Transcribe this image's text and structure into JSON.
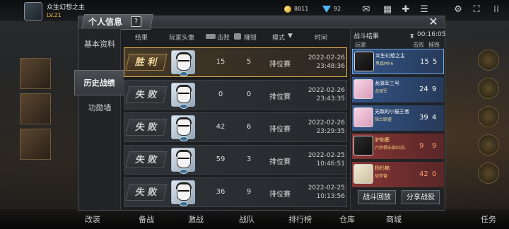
{
  "hud": {
    "player_name": "众生幻想之主",
    "level": "LV.21",
    "mid_text": "",
    "coins": "8011",
    "gems": "92"
  },
  "panel": {
    "title": "个人信息",
    "help": "?",
    "close": "✕"
  },
  "menu": {
    "items": [
      {
        "label": "基本资料",
        "active": false
      },
      {
        "label": "历史战绩",
        "active": true
      },
      {
        "label": "功勋墙",
        "active": false
      }
    ]
  },
  "table": {
    "headers": {
      "result": "结果",
      "avatar": "玩家头像",
      "kills": "击败",
      "destroyed": "摧毁",
      "mode": "模式",
      "mode_arrow": "▼",
      "time": "时间"
    },
    "rows": [
      {
        "result": "胜 利",
        "win": true,
        "kills": "15",
        "destroyed": "5",
        "mode": "排位赛",
        "date": "2022-02-26",
        "time": "23:48:36"
      },
      {
        "result": "失 败",
        "win": false,
        "kills": "0",
        "destroyed": "0",
        "mode": "排位赛",
        "date": "2022-02-26",
        "time": "23:43:35"
      },
      {
        "result": "失 败",
        "win": false,
        "kills": "42",
        "destroyed": "6",
        "mode": "排位赛",
        "date": "2022-02-26",
        "time": "23:29:35"
      },
      {
        "result": "失 败",
        "win": false,
        "kills": "59",
        "destroyed": "3",
        "mode": "排位赛",
        "date": "2022-02-25",
        "time": "10:46:51"
      },
      {
        "result": "失 败",
        "win": false,
        "kills": "36",
        "destroyed": "9",
        "mode": "排位赛",
        "date": "2022-02-25",
        "time": "10:13:56"
      }
    ]
  },
  "detail": {
    "title": "战斗结果",
    "timer": "00:16:05",
    "head_player": "玩家",
    "head_kills": "击败",
    "head_destroyed": "摧毁",
    "players": [
      {
        "name": "众生幻想之主",
        "sub": "黑森林F6",
        "kills": "15",
        "destroyed": "5",
        "team": "blue",
        "self": true,
        "avatar": "dark"
      },
      {
        "name": "龙骑军三号",
        "sub": "龙骑军",
        "kills": "24",
        "destroyed": "9",
        "team": "blue",
        "self": false,
        "avatar": "pink"
      },
      {
        "name": "无敌的小猫王者",
        "sub": "骑士联盟",
        "kills": "39",
        "destroyed": "4",
        "team": "blue",
        "self": false,
        "avatar": "pink"
      },
      {
        "name": "驴和鹿",
        "sub": "六杀俱乐部01队",
        "kills": "9",
        "destroyed": "9",
        "team": "red",
        "self": false,
        "avatar": "dark"
      },
      {
        "name": "杨杉楠",
        "sub": "战斧营",
        "kills": "42",
        "destroyed": "0",
        "team": "red",
        "self": false,
        "avatar": "cream"
      }
    ],
    "replay_button": "战斗回放",
    "share_button": "分享战役"
  },
  "bottom_nav": [
    "改装",
    "备战",
    "激战",
    "战队",
    "排行榜",
    "仓库",
    "商城"
  ],
  "right_side": {
    "task": "任务"
  },
  "colors": {
    "win_border": "#d8a84a",
    "blue_team": "#34588c",
    "red_team": "#8c3636"
  }
}
